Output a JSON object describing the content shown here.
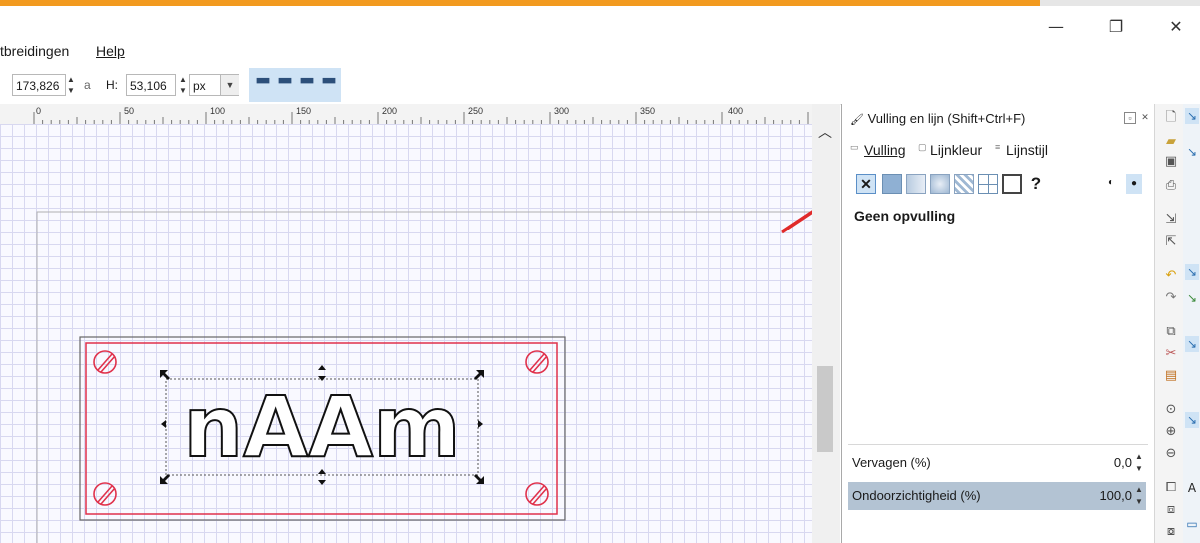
{
  "window": {
    "minimize_glyph": "—",
    "restore_glyph": "❐",
    "close_glyph": "✕"
  },
  "menu": {
    "items": [
      "tbreidingen",
      "Help"
    ]
  },
  "toolbar": {
    "width_value": "173,826",
    "lock_glyph": "a",
    "h_label": "H:",
    "height_value": "53,106",
    "unit_value": "px"
  },
  "ruler": {
    "ticks": [
      "0",
      "50",
      "100",
      "150",
      "200",
      "250",
      "300",
      "350",
      "400"
    ]
  },
  "canvas": {
    "text": "nAAm"
  },
  "colors": {
    "accent": "#f29a1f",
    "red_frame": "#e0314b",
    "arrow": "#e02a2a",
    "selected_fill": "#cfe3f5"
  },
  "panel": {
    "title": "Vulling en lijn (Shift+Ctrl+F)",
    "tabs": [
      "Vulling",
      "Lijnkleur",
      "Lijnstijl"
    ],
    "fill_buttons": [
      "no-paint",
      "flat-color",
      "linear-gradient",
      "radial-gradient",
      "pattern",
      "swatch",
      "unset",
      "unknown"
    ],
    "unknown_glyph": "?",
    "no_fill_label": "Geen opvulling",
    "blur_label": "Vervagen (%)",
    "blur_value": "0,0",
    "opacity_label": "Ondoorzichtigheid (%)",
    "opacity_value": "100,0"
  }
}
